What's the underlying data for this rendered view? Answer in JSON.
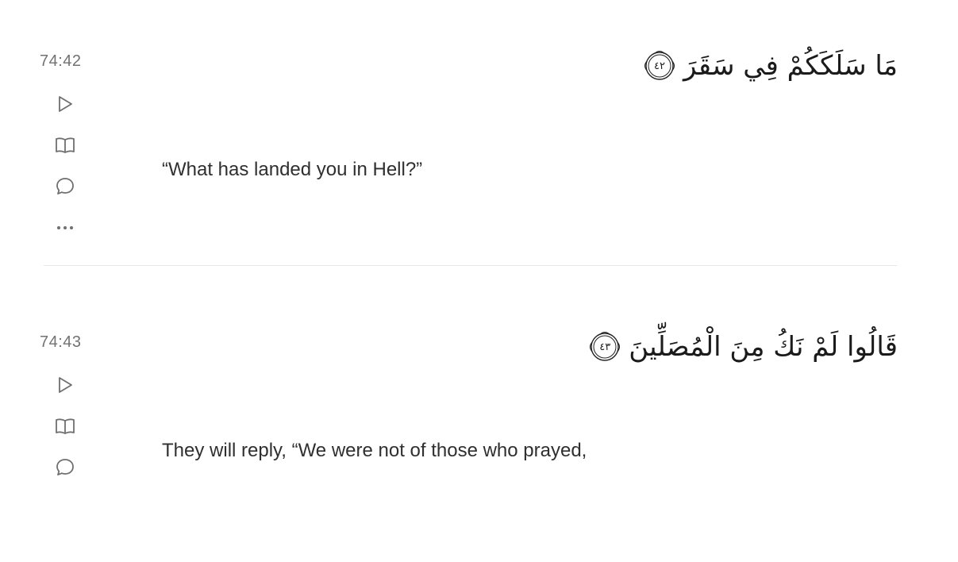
{
  "verses": [
    {
      "key": "74:42",
      "arabic": "مَا سَلَكَكُمْ فِي سَقَرَ",
      "ayah_number": "٤٢",
      "translation": "“What has landed you in Hell?”",
      "actions": [
        {
          "name": "play",
          "icon": "play-icon"
        },
        {
          "name": "tafsir",
          "icon": "book-icon"
        },
        {
          "name": "reflections",
          "icon": "comment-icon"
        },
        {
          "name": "more",
          "icon": "ellipsis-icon"
        }
      ]
    },
    {
      "key": "74:43",
      "arabic": "قَالُوا لَمْ نَكُ مِنَ الْمُصَلِّينَ",
      "ayah_number": "٤٣",
      "translation": "They will reply, “We were not of those who prayed,",
      "actions": [
        {
          "name": "play",
          "icon": "play-icon"
        },
        {
          "name": "tafsir",
          "icon": "book-icon"
        },
        {
          "name": "reflections",
          "icon": "comment-icon"
        }
      ]
    }
  ],
  "colors": {
    "verse_key": "#727272",
    "icon": "#6f6f6f",
    "divider": "#e6e6e6",
    "text": "#2f2f2f"
  }
}
